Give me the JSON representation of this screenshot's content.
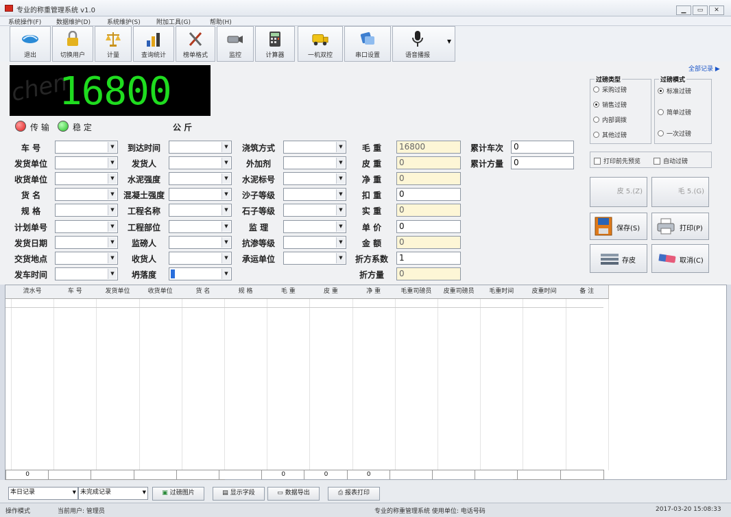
{
  "window": {
    "title": "专业的称重管理系统 v1.0",
    "controls": [
      "▁",
      "▭",
      "✕"
    ]
  },
  "menu": [
    "系统操作(F)",
    "数据维护(D)",
    "系统维护(S)",
    "附加工具(G)",
    "帮助(H)"
  ],
  "toolbar": [
    {
      "label": "退出",
      "icon": "exit-icon"
    },
    {
      "label": "切换用户",
      "icon": "switch-user-icon"
    },
    {
      "label": "计量",
      "icon": "scale-icon"
    },
    {
      "label": "查询统计",
      "icon": "statistics-icon"
    },
    {
      "label": "榜单格式",
      "icon": "tools-icon"
    },
    {
      "label": "监控",
      "icon": "camera-icon"
    },
    {
      "label": "计算器",
      "icon": "calculator-icon"
    },
    {
      "label": "一机双控",
      "icon": "truck-icon"
    },
    {
      "label": "串口设置",
      "icon": "serial-port-icon"
    },
    {
      "label": "语音播报",
      "icon": "microphone-icon"
    }
  ],
  "toolbar_dropdown": "▾",
  "all_records_link": "全部记录 ▶",
  "display": {
    "value": "16800",
    "unit": "公 斤",
    "watermark": "chem"
  },
  "status_lamps": [
    {
      "label": "传 输",
      "color": "#e01e1e"
    },
    {
      "label": "稳 定",
      "color": "#25c025"
    }
  ],
  "fields": {
    "col1": [
      "车 号",
      "发货单位",
      "收货单位",
      "货 名",
      "规 格",
      "计划单号",
      "发货日期",
      "交货地点",
      "发车时间"
    ],
    "col2": [
      "到达时间",
      "发货人",
      "水泥强度",
      "混凝土强度",
      "工程名称",
      "工程部位",
      "监磅人",
      "收货人",
      "坍落度"
    ],
    "col3": [
      "浇筑方式",
      "外加剂",
      "水泥标号",
      "沙子等级",
      "石子等级",
      "监 理",
      "抗渗等级",
      "承运单位"
    ],
    "col4": [
      {
        "label": "毛 重",
        "value": "16800",
        "yellow": true
      },
      {
        "label": "皮 重",
        "value": "0",
        "yellow": true
      },
      {
        "label": "净 重",
        "value": "0",
        "yellow": true
      },
      {
        "label": "扣 重",
        "value": "0",
        "yellow": false
      },
      {
        "label": "实 重",
        "value": "0",
        "yellow": true
      },
      {
        "label": "单 价",
        "value": "0",
        "yellow": false
      },
      {
        "label": "金 额",
        "value": "0",
        "yellow": true
      },
      {
        "label": "折方系数",
        "value": "1",
        "yellow": false
      },
      {
        "label": "折方量",
        "value": "0",
        "yellow": true
      }
    ],
    "col5": [
      {
        "label": "累计车次",
        "value": "0"
      },
      {
        "label": "累计方量",
        "value": "0"
      }
    ]
  },
  "weigh_type": {
    "title": "过磅类型",
    "options": [
      "采购过磅",
      "销售过磅",
      "内部调拨",
      "其他过磅"
    ],
    "selected": 1
  },
  "weigh_mode": {
    "title": "过磅模式",
    "options": [
      "标准过磅",
      "简单过磅",
      "一次过磅"
    ],
    "selected": 0
  },
  "checkboxes": [
    "打印前先预览",
    "自动过磅"
  ],
  "buttons": {
    "f5": "皮 5.(Z)",
    "f6": "毛 5.(G)",
    "save": "保存(S)",
    "print": "打印(P)",
    "store": "存皮",
    "cancel": "取消(C)"
  },
  "table": {
    "headers": [
      "流水号",
      "车 号",
      "发货单位",
      "收货单位",
      "货 名",
      "规 格",
      "毛 重",
      "皮 重",
      "净 重",
      "毛重司磅员",
      "皮重司磅员",
      "毛重时间",
      "皮重时间",
      "备 注"
    ],
    "footer": [
      "0",
      "",
      "",
      "",
      "",
      "",
      "0",
      "0",
      "0",
      "",
      "",
      "",
      "",
      ""
    ]
  },
  "bottom": {
    "select1": "本日记录",
    "select2": "未完成记录",
    "btn_image": "过磅图片",
    "btn_fields": "显示字段",
    "btn_export": "数据导出",
    "btn_print": "报表打印"
  },
  "status": {
    "left": "操作模式",
    "user": "当前用户: 管理员",
    "middle": "专业的称重管理系统 使用单位: 电话号码",
    "time": "2017-03-20 15:08:33"
  }
}
